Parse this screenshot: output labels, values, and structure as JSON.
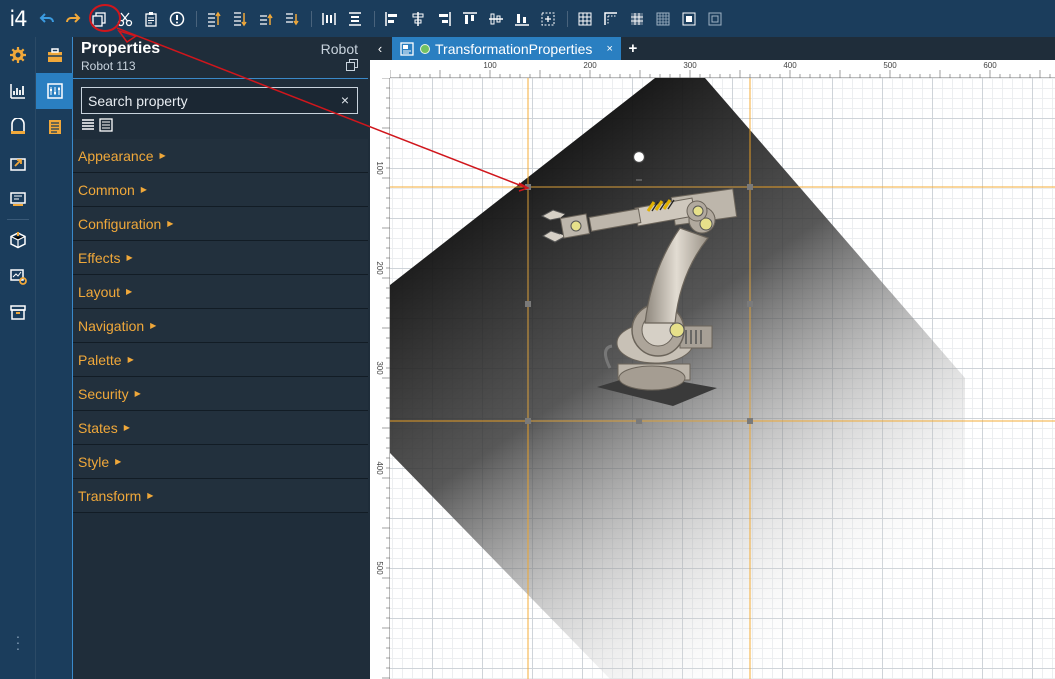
{
  "app": {
    "logo": "i4"
  },
  "toolbar": {
    "icons": [
      "undo-icon",
      "redo-icon",
      "duplicate-icon",
      "cut-icon",
      "paste-icon",
      "warning-icon",
      "bring-front-icon",
      "send-back-icon",
      "bring-forward-icon",
      "send-backward-icon",
      "distribute-h-icon",
      "distribute-v-icon",
      "align-left-icon",
      "align-center-icon",
      "align-right-icon",
      "align-top-icon",
      "align-middle-icon",
      "align-bottom-icon",
      "center-icon",
      "grid-icon",
      "snap-guides-icon",
      "grid-snap-icon",
      "grid-fine-icon",
      "grid-toggle-icon",
      "fit-icon"
    ]
  },
  "properties": {
    "title": "Properties",
    "subtitle": "Robot 113",
    "type": "Robot",
    "search_placeholder": "Search property",
    "search_clear": "×",
    "categories": [
      "Appearance",
      "Common",
      "Configuration",
      "Effects",
      "Layout",
      "Navigation",
      "Palette",
      "Security",
      "States",
      "Style",
      "Transform"
    ]
  },
  "tabs": {
    "prev": "‹",
    "active": {
      "label": "TransformationProperties",
      "close": "×"
    },
    "add": "+"
  },
  "ruler": {
    "top_labels": [
      "100",
      "200",
      "300",
      "400",
      "500",
      "600"
    ],
    "left_labels": [
      "100",
      "200",
      "300",
      "400",
      "500"
    ]
  },
  "colors": {
    "accent": "#2a7fc1",
    "category_text": "#f0a83a",
    "annotation": "#d0161c",
    "guide": "#f5a623"
  }
}
